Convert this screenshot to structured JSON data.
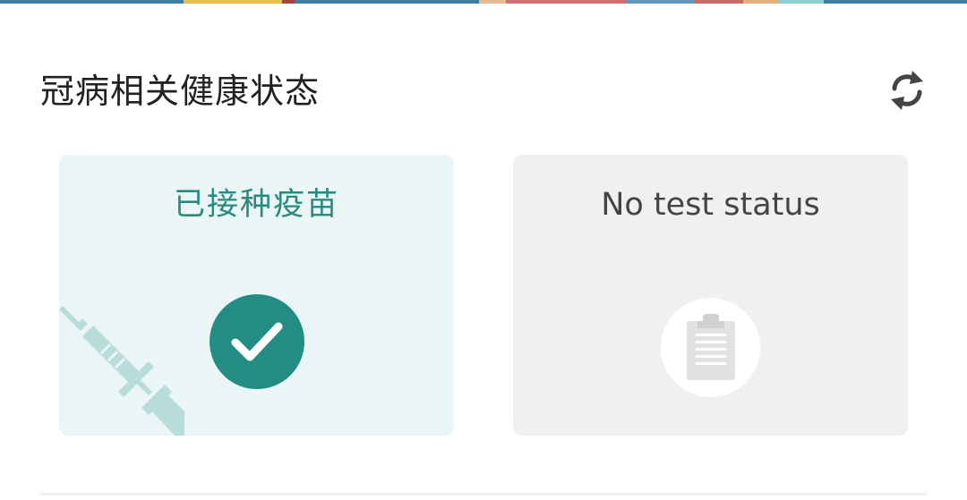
{
  "header": {
    "title": "冠病相关健康状态",
    "refresh_icon": "refresh-icon"
  },
  "cards": {
    "vaccination": {
      "title": "已接种疫苗",
      "icon": "check-icon",
      "decoration_icon": "syringe-icon"
    },
    "test": {
      "title": "No test status",
      "icon": "clipboard-icon"
    }
  },
  "colors": {
    "vaccinated_card_bg": "#eaf6f6",
    "vaccinated_accent": "#238d84",
    "vaccinated_title": "#2a8a7f",
    "test_card_bg": "#f0f0f0",
    "test_title": "#444444",
    "syringe": "#b7dcd9",
    "clipboard": "#e2e2e2"
  }
}
